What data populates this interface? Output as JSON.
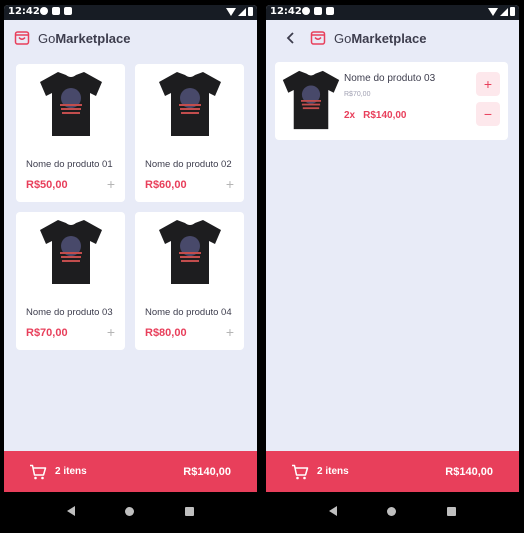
{
  "colors": {
    "accent": "#e83f5b",
    "background": "#e8ebf7",
    "statusbar": "#171c24"
  },
  "status": {
    "time": "12:42"
  },
  "app": {
    "title_prefix": "Go",
    "title_bold": "Marketplace",
    "logo_icon": "shopping-bag-icon"
  },
  "products": [
    {
      "name": "Nome do produto 01",
      "price": "R$50,00"
    },
    {
      "name": "Nome do produto 02",
      "price": "R$60,00"
    },
    {
      "name": "Nome do produto 03",
      "price": "R$70,00"
    },
    {
      "name": "Nome do produto 04",
      "price": "R$80,00"
    }
  ],
  "cart": {
    "items": [
      {
        "name": "Nome do produto 03",
        "unit_price": "R$70,00",
        "quantity": "2x",
        "subtotal": "R$140,00"
      }
    ],
    "increment_label": "+",
    "decrement_label": "−"
  },
  "footer": {
    "count": "2 itens",
    "total": "R$140,00"
  },
  "add_label": "+"
}
